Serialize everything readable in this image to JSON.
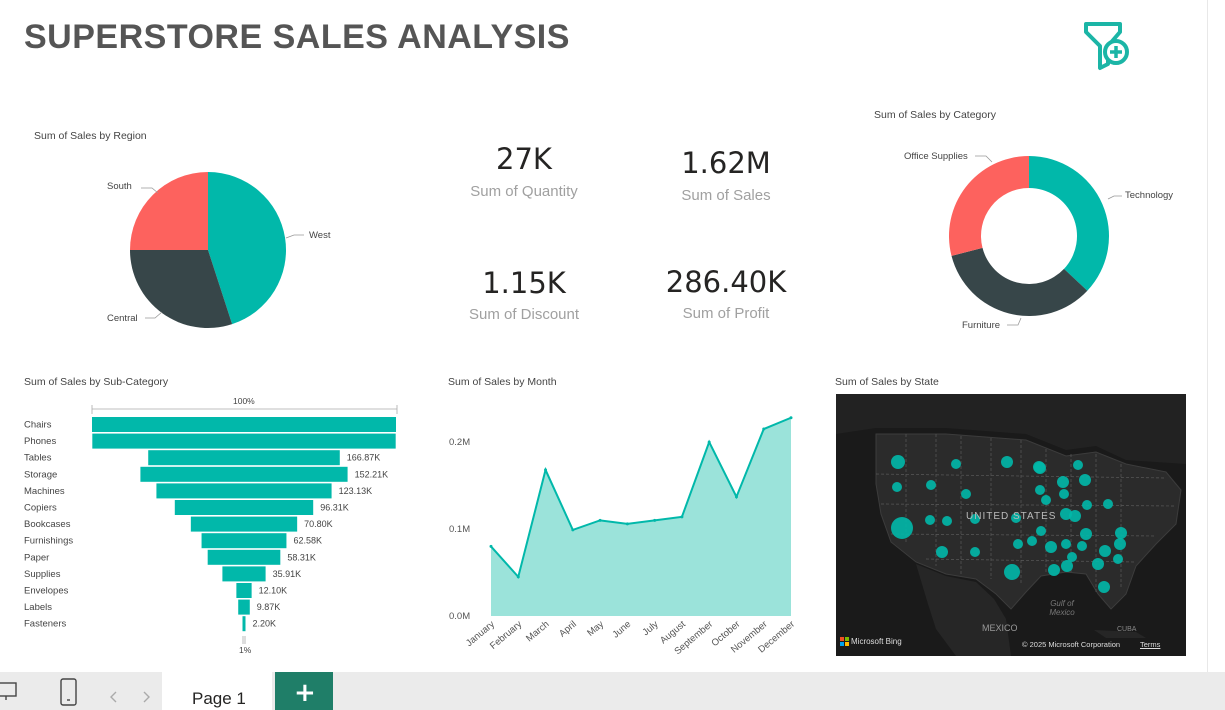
{
  "title": "SUPERSTORE SALES ANALYSIS",
  "colors": {
    "teal": "#01b8aa",
    "dark": "#374649",
    "red": "#fd625e",
    "area": "#9be3da",
    "tab": "#1f7e68"
  },
  "icons": {
    "filter_add": "filter-plus-icon"
  },
  "cards": [
    {
      "value": "27K",
      "label": "Sum of Quantity"
    },
    {
      "value": "1.62M",
      "label": "Sum of Sales"
    },
    {
      "value": "1.15K",
      "label": "Sum of Discount"
    },
    {
      "value": "286.40K",
      "label": "Sum of Profit"
    }
  ],
  "region_pie": {
    "title": "Sum of Sales by Region",
    "labels": {
      "south": "South",
      "west": "West",
      "central": "Central"
    }
  },
  "category_donut": {
    "title": "Sum of Sales by Category",
    "labels": {
      "office": "Office Supplies",
      "tech": "Technology",
      "furniture": "Furniture"
    }
  },
  "funnel": {
    "title": "Sum of Sales by Sub-Category",
    "top_label": "100%",
    "bottom_label": "1%"
  },
  "line": {
    "title": "Sum of Sales by Month"
  },
  "map": {
    "title": "Sum of Sales by State",
    "country": "UNITED STATES",
    "mexico": "MEXICO",
    "gulf": "Gulf of Mexico",
    "cuba": "CUBA",
    "bing": "Microsoft Bing",
    "copyright": "© 2025 Microsoft Corporation",
    "terms": "Terms"
  },
  "footer": {
    "page_tab": "Page 1",
    "add": "+"
  },
  "chart_data": [
    {
      "type": "pie",
      "title": "Sum of Sales by Region",
      "categories": [
        "West",
        "Central",
        "South"
      ],
      "values": [
        0.45,
        0.3,
        0.25
      ],
      "colors": [
        "#01b8aa",
        "#374649",
        "#fd625e"
      ]
    },
    {
      "type": "pie",
      "title": "Sum of Sales by Category",
      "donut": true,
      "categories": [
        "Technology",
        "Furniture",
        "Office Supplies"
      ],
      "values": [
        0.37,
        0.34,
        0.29
      ],
      "colors": [
        "#01b8aa",
        "#374649",
        "#fd625e"
      ]
    },
    {
      "type": "bar",
      "title": "Sum of Sales by Sub-Category",
      "orientation": "funnel",
      "categories": [
        "Chairs",
        "Phones",
        "Tables",
        "Storage",
        "Machines",
        "Copiers",
        "Bookcases",
        "Furnishings",
        "Paper",
        "Supplies",
        "Envelopes",
        "Labels",
        "Fasteners"
      ],
      "values": [
        328450,
        327780,
        206970,
        223840,
        189240,
        149530,
        114880,
        91710,
        78480,
        46670,
        16480,
        12490,
        3020
      ],
      "data_labels": [
        "",
        "",
        "166.87K",
        "152.21K",
        "123.13K",
        "96.31K",
        "70.80K",
        "62.58K",
        "58.31K",
        "35.91K",
        "12.10K",
        "9.87K",
        "2.20K"
      ]
    },
    {
      "type": "area",
      "title": "Sum of Sales by Month",
      "x": [
        "January",
        "February",
        "March",
        "April",
        "May",
        "June",
        "July",
        "August",
        "September",
        "October",
        "November",
        "December"
      ],
      "values": [
        0.08,
        0.045,
        0.168,
        0.099,
        0.11,
        0.106,
        0.11,
        0.114,
        0.2,
        0.137,
        0.215,
        0.228
      ],
      "y_ticks": [
        "0.0M",
        "0.1M",
        "0.2M"
      ],
      "ylim": [
        0,
        0.23
      ],
      "unit": "M"
    }
  ]
}
